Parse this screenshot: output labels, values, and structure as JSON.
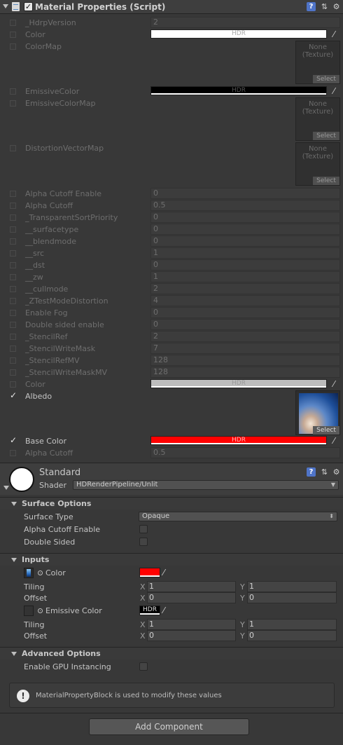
{
  "component": {
    "title": "Material Properties (Script)",
    "enabled": true,
    "icons": [
      "help-icon",
      "preset-icon",
      "settings-gear-icon"
    ]
  },
  "properties": [
    {
      "name": "_HdrpVersion",
      "value": "2",
      "checked": false
    },
    {
      "name": "Color",
      "value": "HDR",
      "checked": false,
      "color": "#ffffff"
    },
    {
      "name": "ColorMap",
      "texture": "None\n(Texture)",
      "select": "Select",
      "checked": false
    },
    {
      "name": "EmissiveColor",
      "value": "HDR",
      "checked": false,
      "color": "#000000"
    },
    {
      "name": "EmissiveColorMap",
      "texture": "None\n(Texture)",
      "select": "Select",
      "checked": false
    },
    {
      "name": "DistortionVectorMap",
      "texture": "None\n(Texture)",
      "select": "Select",
      "checked": false
    },
    {
      "name": "Alpha Cutoff Enable",
      "value": "0",
      "checked": false
    },
    {
      "name": "Alpha Cutoff",
      "value": "0.5",
      "checked": false
    },
    {
      "name": "_TransparentSortPriority",
      "value": "0",
      "checked": false
    },
    {
      "name": "__surfacetype",
      "value": "0",
      "checked": false
    },
    {
      "name": "__blendmode",
      "value": "0",
      "checked": false
    },
    {
      "name": "__src",
      "value": "1",
      "checked": false
    },
    {
      "name": "__dst",
      "value": "0",
      "checked": false
    },
    {
      "name": "__zw",
      "value": "1",
      "checked": false
    },
    {
      "name": "__cullmode",
      "value": "2",
      "checked": false
    },
    {
      "name": "_ZTestModeDistortion",
      "value": "4",
      "checked": false
    },
    {
      "name": "Enable Fog",
      "value": "0",
      "checked": false
    },
    {
      "name": "Double sided enable",
      "value": "0",
      "checked": false
    },
    {
      "name": "_StencilRef",
      "value": "2",
      "checked": false
    },
    {
      "name": "_StencilWriteMask",
      "value": "7",
      "checked": false
    },
    {
      "name": "_StencilRefMV",
      "value": "128",
      "checked": false
    },
    {
      "name": "_StencilWriteMaskMV",
      "value": "128",
      "checked": false
    },
    {
      "name": "Color",
      "value": "HDR",
      "checked": false,
      "color": "#bdbdbd"
    },
    {
      "name": "Albedo",
      "select": "Select",
      "checked": true
    },
    {
      "name": "Base Color",
      "value": "HDR",
      "checked": true,
      "color": "#ff0000"
    },
    {
      "name": "Alpha Cutoff",
      "value": "0.5",
      "checked": false
    }
  ],
  "material": {
    "name": "Standard",
    "shader_label": "Shader",
    "shader": "HDRenderPipeline/Unlit"
  },
  "surface_options": {
    "title": "Surface Options",
    "surface_type_label": "Surface Type",
    "surface_type": "Opaque",
    "alpha_cutoff_label": "Alpha Cutoff Enable",
    "double_sided_label": "Double Sided"
  },
  "inputs": {
    "title": "Inputs",
    "color_label": "Color",
    "color": "#ff0000",
    "emissive_label": "Emissive Color",
    "emissive_value": "HDR",
    "tiling_label": "Tiling",
    "offset_label": "Offset",
    "x_label": "X",
    "y_label": "Y",
    "color_tiling": [
      "1",
      "1"
    ],
    "color_offset": [
      "0",
      "0"
    ],
    "emissive_tiling": [
      "1",
      "1"
    ],
    "emissive_offset": [
      "0",
      "0"
    ]
  },
  "advanced_options": {
    "title": "Advanced Options",
    "gpu_instancing_label": "Enable GPU Instancing"
  },
  "info": {
    "message": "MaterialPropertyBlock is used to modify these values"
  },
  "add_component": "Add Component"
}
